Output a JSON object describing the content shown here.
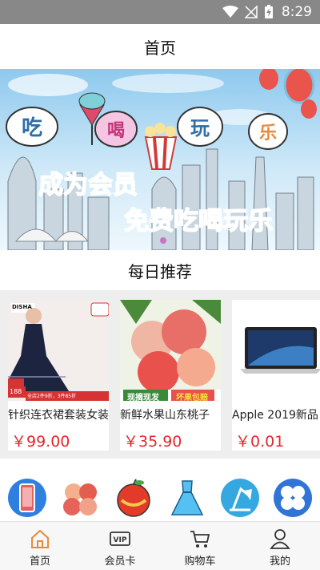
{
  "status_bar": {
    "time": "8:29"
  },
  "header": {
    "title": "首页"
  },
  "banner": {
    "bubble_chars": [
      "吃",
      "喝",
      "玩",
      "乐"
    ],
    "headline_1": "成为会员",
    "headline_2": "免费吃喝玩乐"
  },
  "recommend": {
    "title": "每日推荐",
    "products": [
      {
        "name": "针织连衣裙套装女装",
        "price": "￥99.00",
        "img_brand": "DISHA",
        "img_price": "188",
        "img_promo": "全店2件9折，3件85折"
      },
      {
        "name": "新鲜水果山东桃子",
        "price": "￥35.90",
        "img_caption_1": "现摘现发",
        "img_caption_2": "坏果包赔"
      },
      {
        "name": "Apple 2019新品",
        "price": "￥0.01"
      }
    ]
  },
  "categories": [
    {
      "icon": "phone-icon"
    },
    {
      "icon": "peaches-icon"
    },
    {
      "icon": "apple-icon"
    },
    {
      "icon": "dress-icon"
    },
    {
      "icon": "desk-lamp-icon"
    },
    {
      "icon": "four-petal-icon"
    }
  ],
  "tabbar": {
    "tabs": [
      {
        "label": "首页",
        "icon": "home-icon"
      },
      {
        "label": "会员卡",
        "icon": "vip-card-icon",
        "icon_text": "VIP"
      },
      {
        "label": "购物车",
        "icon": "cart-icon"
      },
      {
        "label": "我的",
        "icon": "user-icon"
      }
    ]
  },
  "colors": {
    "price": "#e3272d",
    "status_bar": "#888888",
    "banner_red": "#e02a2a",
    "accent_orange": "#e88a3a"
  }
}
